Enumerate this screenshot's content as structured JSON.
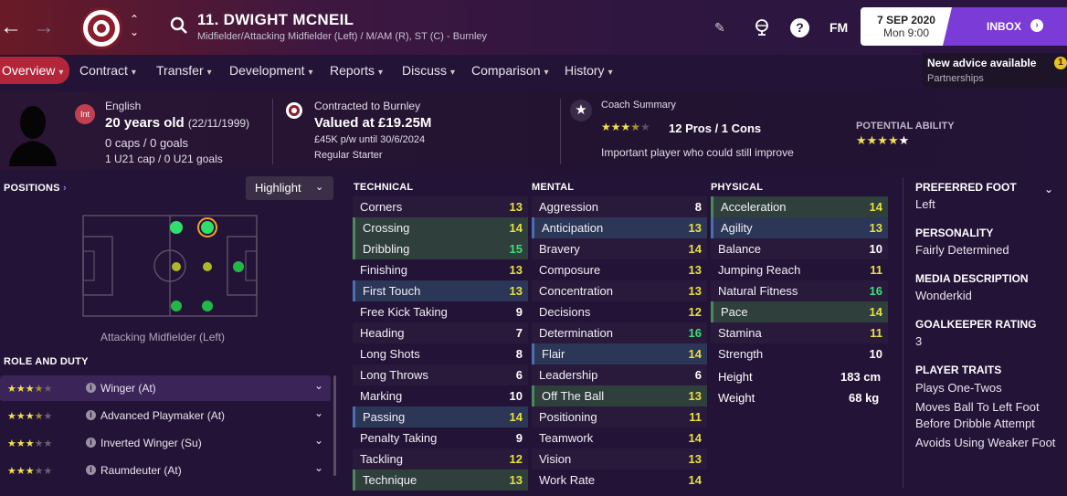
{
  "header": {
    "name": "11. DWIGHT MCNEIL",
    "subtitle": "Midfielder/Attacking Midfielder (Left) / M/AM (R), ST (C) - Burnley",
    "brand": "FM",
    "date": "7 SEP 2020",
    "time": "Mon 9:00",
    "inbox_label": "INBOX",
    "advice_title": "New advice available",
    "advice_sub": "Partnerships",
    "advice_badge": "1"
  },
  "nav": {
    "items": [
      "Overview",
      "Contract",
      "Transfer",
      "Development",
      "Reports",
      "Discuss",
      "Comparison",
      "History"
    ]
  },
  "info": {
    "nation_badge": "Int",
    "nationality": "English",
    "age": "20 years old",
    "dob": "(22/11/1999)",
    "caps": "0 caps / 0 goals",
    "u21": "1 U21 cap / 0 U21 goals",
    "contract_label": "Contracted to Burnley",
    "value": "Valued at £19.25M",
    "wage": "£45K p/w until 30/6/2024",
    "status": "Regular Starter",
    "coach_label": "Coach Summary",
    "pros_cons": "12 Pros / 1 Cons",
    "coach_text": "Important player who could still improve",
    "pa_label": "POTENTIAL ABILITY"
  },
  "positions": {
    "title": "POSITIONS",
    "highlight_label": "Highlight",
    "caption": "Attacking Midfielder (Left)"
  },
  "roles": {
    "title": "ROLE AND DUTY",
    "items": [
      {
        "name": "Winger (At)",
        "stars": 3.5
      },
      {
        "name": "Advanced Playmaker (At)",
        "stars": 3.5
      },
      {
        "name": "Inverted Winger (Su)",
        "stars": 3
      },
      {
        "name": "Raumdeuter (At)",
        "stars": 3
      }
    ]
  },
  "technical": {
    "title": "TECHNICAL",
    "rows": [
      {
        "name": "Corners",
        "value": "13"
      },
      {
        "name": "Crossing",
        "value": "14"
      },
      {
        "name": "Dribbling",
        "value": "15"
      },
      {
        "name": "Finishing",
        "value": "13"
      },
      {
        "name": "First Touch",
        "value": "13"
      },
      {
        "name": "Free Kick Taking",
        "value": "9"
      },
      {
        "name": "Heading",
        "value": "7"
      },
      {
        "name": "Long Shots",
        "value": "8"
      },
      {
        "name": "Long Throws",
        "value": "6"
      },
      {
        "name": "Marking",
        "value": "10"
      },
      {
        "name": "Passing",
        "value": "14"
      },
      {
        "name": "Penalty Taking",
        "value": "9"
      },
      {
        "name": "Tackling",
        "value": "12"
      },
      {
        "name": "Technique",
        "value": "13"
      }
    ]
  },
  "mental": {
    "title": "MENTAL",
    "rows": [
      {
        "name": "Aggression",
        "value": "8"
      },
      {
        "name": "Anticipation",
        "value": "13"
      },
      {
        "name": "Bravery",
        "value": "14"
      },
      {
        "name": "Composure",
        "value": "13"
      },
      {
        "name": "Concentration",
        "value": "13"
      },
      {
        "name": "Decisions",
        "value": "12"
      },
      {
        "name": "Determination",
        "value": "16"
      },
      {
        "name": "Flair",
        "value": "14"
      },
      {
        "name": "Leadership",
        "value": "6"
      },
      {
        "name": "Off The Ball",
        "value": "13"
      },
      {
        "name": "Positioning",
        "value": "11"
      },
      {
        "name": "Teamwork",
        "value": "14"
      },
      {
        "name": "Vision",
        "value": "13"
      },
      {
        "name": "Work Rate",
        "value": "14"
      }
    ]
  },
  "physical": {
    "title": "PHYSICAL",
    "rows": [
      {
        "name": "Acceleration",
        "value": "14"
      },
      {
        "name": "Agility",
        "value": "13"
      },
      {
        "name": "Balance",
        "value": "10"
      },
      {
        "name": "Jumping Reach",
        "value": "11"
      },
      {
        "name": "Natural Fitness",
        "value": "16"
      },
      {
        "name": "Pace",
        "value": "14"
      },
      {
        "name": "Stamina",
        "value": "11"
      },
      {
        "name": "Strength",
        "value": "10"
      }
    ],
    "height_label": "Height",
    "height": "183 cm",
    "weight_label": "Weight",
    "weight": "68 kg"
  },
  "side": {
    "foot_label": "PREFERRED FOOT",
    "foot": "Left",
    "personality_label": "PERSONALITY",
    "personality": "Fairly Determined",
    "media_label": "MEDIA DESCRIPTION",
    "media": "Wonderkid",
    "gk_label": "GOALKEEPER RATING",
    "gk": "3",
    "traits_label": "PLAYER TRAITS",
    "traits": [
      "Plays One-Twos",
      "Moves Ball To Left Foot Before Dribble Attempt",
      "Avoids Using Weaker Foot"
    ]
  },
  "colors": {
    "accent": "#b3263a",
    "inbox": "#7b3bd6",
    "good": "#3de07a",
    "mid": "#e8e040"
  }
}
